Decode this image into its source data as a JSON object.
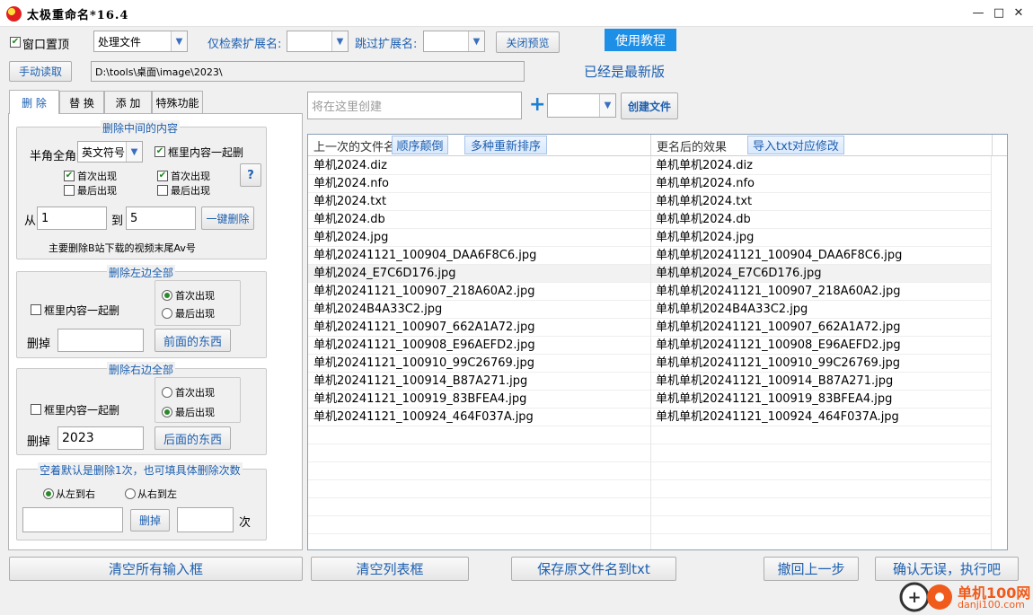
{
  "window": {
    "title": "太极重命名*16.4",
    "minimize": "—",
    "maximize": "□",
    "close": "✕"
  },
  "toolbar": {
    "topmost_label": "窗口置顶",
    "topmost_checked": true,
    "mode_value": "处理文件",
    "only_ext_label": "仅检索扩展名:",
    "only_ext_value": "",
    "skip_ext_label": "跳过扩展名:",
    "skip_ext_value": "",
    "close_preview": "关闭预览",
    "tutorial": "使用教程",
    "manual_read": "手动读取",
    "path": "D:\\tools\\桌面\\image\\2023\\",
    "latest": "已经是最新版"
  },
  "tabs": [
    "删 除",
    "替 换",
    "添 加",
    "特殊功能"
  ],
  "delete_middle": {
    "title": "删除中间的内容",
    "width_label": "半角全角",
    "width_value": "英文符号",
    "with_bracket": "框里内容一起删",
    "first1": "首次出现",
    "last1": "最后出现",
    "first2": "首次出现",
    "last2": "最后出现",
    "help": "?",
    "from_label": "从",
    "from_value": "1",
    "to_label": "到",
    "to_value": "5",
    "one_click": "一键删除",
    "note": "主要删除B站下载的视频末尾Av号"
  },
  "delete_left": {
    "title": "删除左边全部",
    "with_bracket": "框里内容一起删",
    "first": "首次出现",
    "last": "最后出现",
    "remove_label": "删掉",
    "remove_value": "",
    "button": "前面的东西"
  },
  "delete_right": {
    "title": "删除右边全部",
    "with_bracket": "框里内容一起删",
    "first": "首次出现",
    "last": "最后出现",
    "remove_label": "删掉",
    "remove_value": "2023",
    "button": "后面的东西"
  },
  "delete_count": {
    "title": "空着默认是删除1次，也可填具体删除次数",
    "ltr": "从左到右",
    "rtl": "从右到左",
    "text_value": "",
    "button": "删掉",
    "count_value": "",
    "times_label": "次"
  },
  "create": {
    "placeholder": "将在这里创建",
    "plus": "+",
    "type_value": "",
    "button": "创建文件"
  },
  "list": {
    "col_old": "上一次的文件名",
    "col_new": "更名后的效果",
    "btn_reverse": "顺序颠倒",
    "btn_resort": "多种重新排序",
    "btn_import": "导入txt对应修改",
    "rows": [
      {
        "old": "单机2024.diz",
        "new": "单机单机2024.diz"
      },
      {
        "old": "单机2024.nfo",
        "new": "单机单机2024.nfo"
      },
      {
        "old": "单机2024.txt",
        "new": "单机单机2024.txt"
      },
      {
        "old": "单机2024.db",
        "new": "单机单机2024.db"
      },
      {
        "old": "单机2024.jpg",
        "new": "单机单机2024.jpg"
      },
      {
        "old": "单机20241121_100904_DAA6F8C6.jpg",
        "new": "单机单机20241121_100904_DAA6F8C6.jpg"
      },
      {
        "old": "单机2024_E7C6D176.jpg",
        "new": "单机单机2024_E7C6D176.jpg"
      },
      {
        "old": "单机20241121_100907_218A60A2.jpg",
        "new": "单机单机20241121_100907_218A60A2.jpg"
      },
      {
        "old": "单机2024B4A33C2.jpg",
        "new": "单机单机2024B4A33C2.jpg"
      },
      {
        "old": "单机20241121_100907_662A1A72.jpg",
        "new": "单机单机20241121_100907_662A1A72.jpg"
      },
      {
        "old": "单机20241121_100908_E96AEFD2.jpg",
        "new": "单机单机20241121_100908_E96AEFD2.jpg"
      },
      {
        "old": "单机20241121_100910_99C26769.jpg",
        "new": "单机单机20241121_100910_99C26769.jpg"
      },
      {
        "old": "单机20241121_100914_B87A271.jpg",
        "new": "单机单机20241121_100914_B87A271.jpg"
      },
      {
        "old": "单机20241121_100919_83BFEA4.jpg",
        "new": "单机单机20241121_100919_83BFEA4.jpg"
      },
      {
        "old": "单机20241121_100924_464F037A.jpg",
        "new": "单机单机20241121_100924_464F037A.jpg"
      }
    ]
  },
  "bottom": {
    "clear_inputs": "清空所有输入框",
    "clear_list": "清空列表框",
    "save_txt": "保存原文件名到txt",
    "undo": "撤回上一步",
    "execute": "确认无误，执行吧"
  },
  "watermark": {
    "name": "单机100网",
    "url": "danji100.com"
  }
}
